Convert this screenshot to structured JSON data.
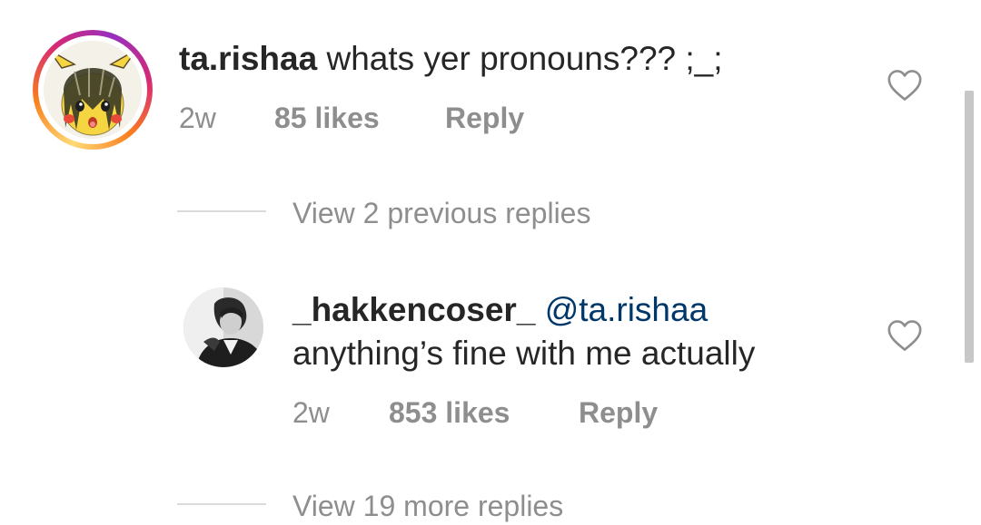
{
  "comment": {
    "avatar": "pikachu-avatar",
    "username": "ta.rishaa",
    "text": "whats yer pronouns??? ;_;",
    "time": "2w",
    "likes": "85 likes",
    "reply_label": "Reply",
    "heart_icon": "heart-outline-icon"
  },
  "view_previous": "View 2 previous replies",
  "reply": {
    "avatar": "user-photo-avatar",
    "username": "_hakkencoser_",
    "mention": "@ta.rishaa",
    "text": "anything’s fine with me actually",
    "time": "2w",
    "likes": "853 likes",
    "reply_label": "Reply",
    "heart_icon": "heart-outline-icon"
  },
  "view_more": "View 19 more replies",
  "colors": {
    "text": "#262626",
    "secondary": "#8e8e8e",
    "mention": "#00376b",
    "divider": "#dbdbdb"
  }
}
